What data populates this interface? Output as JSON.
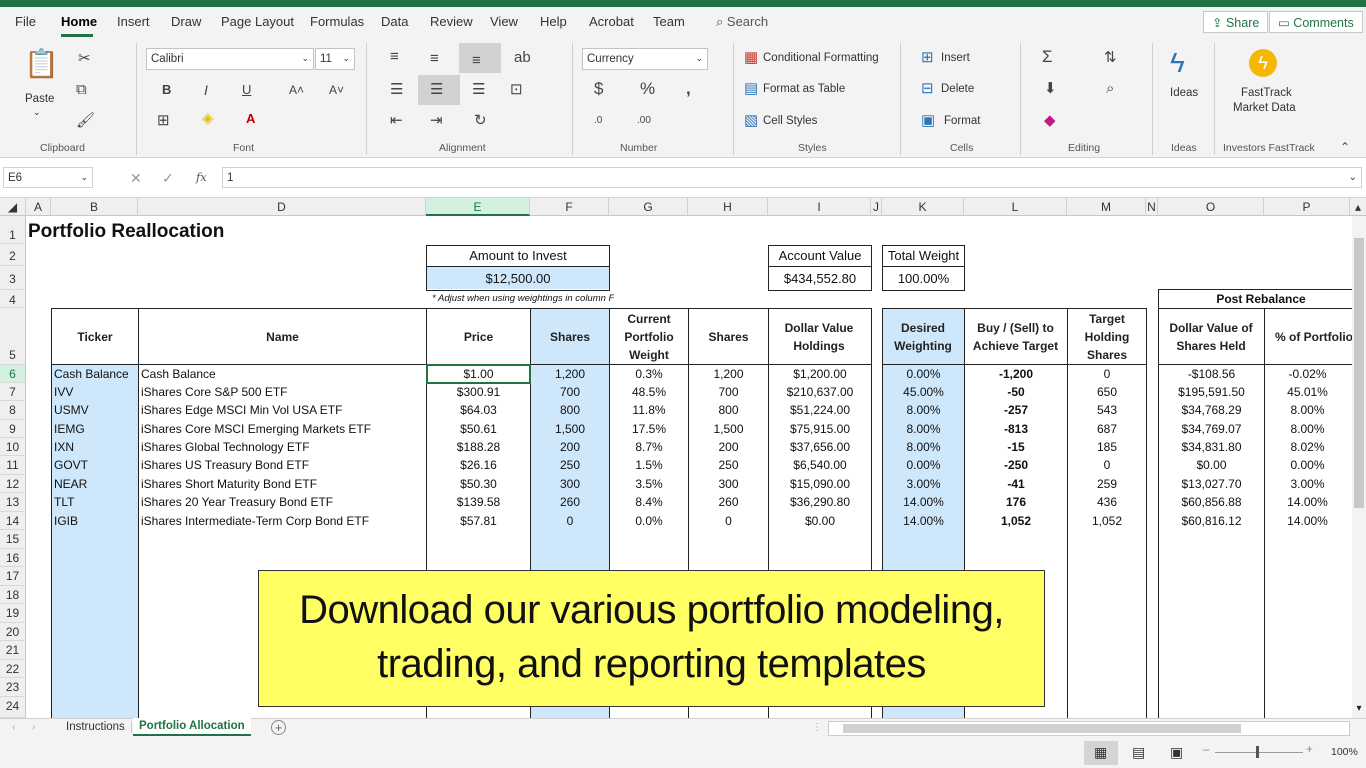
{
  "menu": {
    "tabs": [
      "File",
      "Home",
      "Insert",
      "Draw",
      "Page Layout",
      "Formulas",
      "Data",
      "Review",
      "View",
      "Help",
      "Acrobat",
      "Team"
    ],
    "search": "Search",
    "share": "Share",
    "comments": "Comments"
  },
  "ribbon": {
    "paste": "Paste",
    "font_name": "Calibri",
    "font_size": "11",
    "number_format": "Currency",
    "conditional_formatting": "Conditional Formatting",
    "format_as_table": "Format as Table",
    "cell_styles": "Cell Styles",
    "insert": "Insert",
    "delete": "Delete",
    "format": "Format",
    "ideas": "Ideas",
    "fasttrack_line1": "FastTrack",
    "fasttrack_line2": "Market Data",
    "groups": {
      "clipboard": "Clipboard",
      "font": "Font",
      "alignment": "Alignment",
      "number": "Number",
      "styles": "Styles",
      "cells": "Cells",
      "editing": "Editing",
      "ideas": "Ideas",
      "investors": "Investors FastTrack"
    }
  },
  "formula_bar": {
    "name_box": "E6",
    "fx": "fx",
    "value": "1"
  },
  "columns": [
    "A",
    "B",
    "D",
    "E",
    "F",
    "G",
    "H",
    "I",
    "J",
    "K",
    "L",
    "M",
    "N",
    "O",
    "P"
  ],
  "rows": [
    "1",
    "2",
    "3",
    "4",
    "5",
    "6",
    "7",
    "8",
    "9",
    "10",
    "11",
    "12",
    "13",
    "14",
    "15",
    "16",
    "17",
    "18",
    "19",
    "20",
    "21",
    "22",
    "23",
    "24"
  ],
  "sheet": {
    "title": "Portfolio Reallocation",
    "amount_to_invest_label": "Amount to Invest",
    "amount_to_invest": "$12,500.00",
    "adjust_note": "* Adjust when using weightings in column F",
    "account_value_label": "Account Value",
    "account_value": "$434,552.80",
    "total_weight_label": "Total Weight",
    "total_weight": "100.00%",
    "post_rebalance": "Post Rebalance",
    "headers": {
      "ticker": "Ticker",
      "name": "Name",
      "price": "Price",
      "shares": "Shares",
      "current_weight": "Current Portfolio Weight",
      "shares2": "Shares",
      "dollar_value": "Dollar Value Holdings",
      "desired": "Desired Weighting",
      "buy_sell": "Buy / (Sell) to Achieve Target",
      "target_shares": "Target Holding Shares",
      "dollar_value_held": "Dollar Value of Shares Held",
      "pct_portfolio": "% of Portfolio"
    },
    "rows": [
      {
        "ticker": "Cash Balance",
        "name": "Cash Balance",
        "price": "$1.00",
        "shares": "1,200",
        "weight": "0.3%",
        "shares2": "1,200",
        "holdings": "$1,200.00",
        "desired": "0.00%",
        "buy": "-1,200",
        "target": "0",
        "held": "-$108.56",
        "pct": "-0.02%"
      },
      {
        "ticker": "IVV",
        "name": "iShares Core S&P 500 ETF",
        "price": "$300.91",
        "shares": "700",
        "weight": "48.5%",
        "shares2": "700",
        "holdings": "$210,637.00",
        "desired": "45.00%",
        "buy": "-50",
        "target": "650",
        "held": "$195,591.50",
        "pct": "45.01%"
      },
      {
        "ticker": "USMV",
        "name": "iShares Edge MSCI Min Vol USA ETF",
        "price": "$64.03",
        "shares": "800",
        "weight": "11.8%",
        "shares2": "800",
        "holdings": "$51,224.00",
        "desired": "8.00%",
        "buy": "-257",
        "target": "543",
        "held": "$34,768.29",
        "pct": "8.00%"
      },
      {
        "ticker": "IEMG",
        "name": "iShares Core MSCI Emerging Markets ETF",
        "price": "$50.61",
        "shares": "1,500",
        "weight": "17.5%",
        "shares2": "1,500",
        "holdings": "$75,915.00",
        "desired": "8.00%",
        "buy": "-813",
        "target": "687",
        "held": "$34,769.07",
        "pct": "8.00%"
      },
      {
        "ticker": "IXN",
        "name": "iShares Global Technology ETF",
        "price": "$188.28",
        "shares": "200",
        "weight": "8.7%",
        "shares2": "200",
        "holdings": "$37,656.00",
        "desired": "8.00%",
        "buy": "-15",
        "target": "185",
        "held": "$34,831.80",
        "pct": "8.02%"
      },
      {
        "ticker": "GOVT",
        "name": "iShares US Treasury Bond ETF",
        "price": "$26.16",
        "shares": "250",
        "weight": "1.5%",
        "shares2": "250",
        "holdings": "$6,540.00",
        "desired": "0.00%",
        "buy": "-250",
        "target": "0",
        "held": "$0.00",
        "pct": "0.00%"
      },
      {
        "ticker": "NEAR",
        "name": "iShares Short Maturity Bond ETF",
        "price": "$50.30",
        "shares": "300",
        "weight": "3.5%",
        "shares2": "300",
        "holdings": "$15,090.00",
        "desired": "3.00%",
        "buy": "-41",
        "target": "259",
        "held": "$13,027.70",
        "pct": "3.00%"
      },
      {
        "ticker": "TLT",
        "name": "iShares 20 Year Treasury Bond ETF",
        "price": "$139.58",
        "shares": "260",
        "weight": "8.4%",
        "shares2": "260",
        "holdings": "$36,290.80",
        "desired": "14.00%",
        "buy": "176",
        "target": "436",
        "held": "$60,856.88",
        "pct": "14.00%"
      },
      {
        "ticker": "IGIB",
        "name": "iShares Intermediate-Term Corp Bond ETF",
        "price": "$57.81",
        "shares": "0",
        "weight": "0.0%",
        "shares2": "0",
        "holdings": "$0.00",
        "desired": "14.00%",
        "buy": "1,052",
        "target": "1,052",
        "held": "$60,816.12",
        "pct": "14.00%"
      }
    ]
  },
  "banner": {
    "line1": "Download our various portfolio modeling,",
    "line2": "trading, and reporting templates"
  },
  "sheet_tabs": [
    "Instructions",
    "Portfolio Allocation"
  ],
  "status": {
    "zoom": "100%"
  },
  "colors": {
    "excel_green": "#217346",
    "input_blue": "#cfe7fb",
    "banner_yellow": "#ffff64"
  }
}
